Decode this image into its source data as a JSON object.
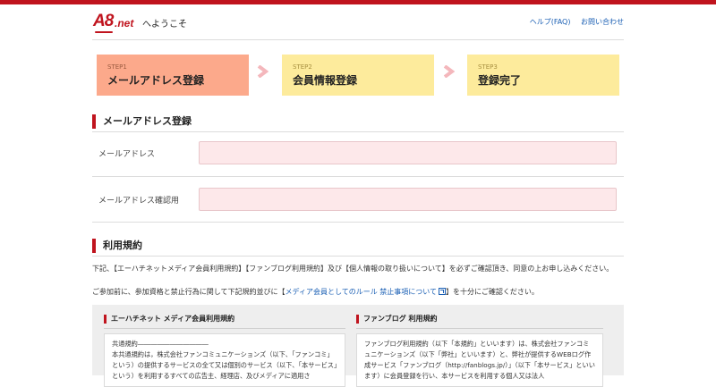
{
  "header": {
    "welcome": "へようこそ",
    "links": [
      "ヘルプ(FAQ)",
      "お問い合わせ"
    ]
  },
  "steps": [
    {
      "label": "STEP1",
      "title": "メールアドレス登録",
      "active": true
    },
    {
      "label": "STEP2",
      "title": "会員情報登録",
      "active": false
    },
    {
      "label": "STEP3",
      "title": "登録完了",
      "active": false
    }
  ],
  "email_section": {
    "title": "メールアドレス登録",
    "email_label": "メールアドレス",
    "email_value": "",
    "confirm_label": "メールアドレス確認用",
    "confirm_value": ""
  },
  "terms_section": {
    "title": "利用規約",
    "text1": "下記、【エーハチネットメディア会員利用規約】【ファンブログ利用規約】及び【個人情報の取り扱いについて】を必ずご確認頂き、同意の上お申し込みください。",
    "text2_before": "ご参加前に、参加資格と禁止行為に関して下記規約並びに【",
    "text2_link": "メディア会員としてのルール 禁止事項について",
    "text2_after": "】を十分にご確認ください。",
    "panel1_title": "エーハチネット メディア会員利用規約",
    "panel1_text": "共通規約―――――――――――\n本共通規約は，株式会社ファンコミュニケーションズ（以下、「ファンコミ」という）の提供するサービスの全て又は個別のサービス（以下、「本サービス」という）を利用するすべての広告主、経理店、及びメディアに適用さ",
    "panel2_title": "ファンブログ 利用規約",
    "panel2_text": "ファンブログ利用規約（以下「本規約」といいます）は、株式会社ファンコミュニケーションズ（以下「弊社」といいます）と、弊社が提供するWEBログ作成サービス「ファンブログ（http://fanblogs.jp/）」（以下「本サービス」といいます）に会員登録を行い、本サービスを利用する個人又は法人"
  },
  "colors": {
    "brand_red": "#c0141e",
    "step_active": "#fca98b",
    "step_inactive": "#fdeb9c",
    "arrow": "#f4b7bc",
    "input_bg": "#fde8ea",
    "link_blue": "#1a5fb4"
  }
}
